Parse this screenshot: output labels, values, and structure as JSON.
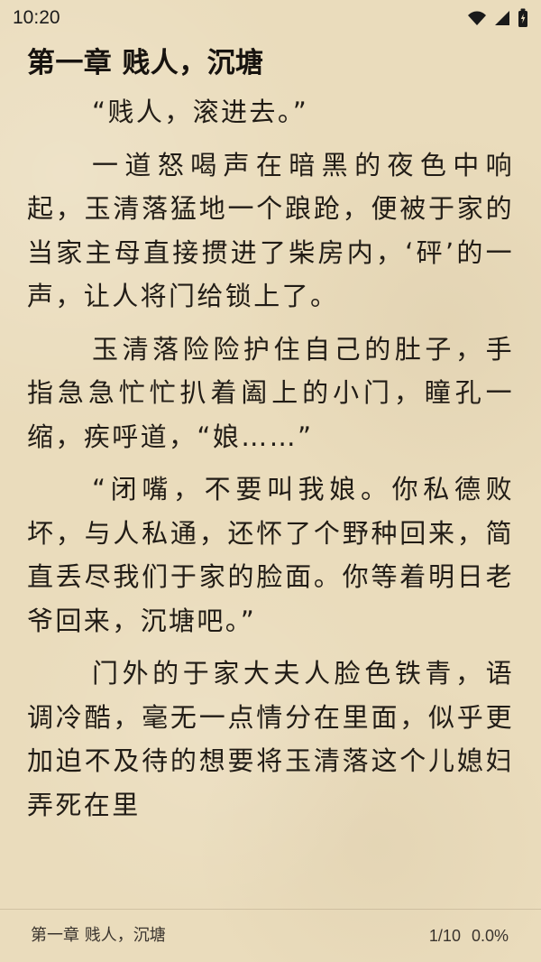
{
  "status_bar": {
    "time": "10:20",
    "icons": [
      "wifi-icon",
      "cellular-signal-icon",
      "battery-charging-icon"
    ]
  },
  "reader": {
    "chapter_title": "第一章  贱人，沉塘",
    "paragraphs": [
      "“贱人，滚进去。”",
      "一道怒喝声在暗黑的夜色中响起，玉清落猛地一个踉跄，便被于家的当家主母直接掼进了柴房内，‘砰’的一声，让人将门给锁上了。",
      "玉清落险险护住自己的肚子，手指急急忙忙扒着阖上的小门，瞳孔一缩，疾呼道，“娘……”",
      "“闭嘴，不要叫我娘。你私德败坏，与人私通，还怀了个野种回来，简直丢尽我们于家的脸面。你等着明日老爷回来，沉塘吧。”",
      "门外的于家大夫人脸色铁青，语调冷酷，毫无一点情分在里面，似乎更加迫不及待的想要将玉清落这个儿媳妇弄死在里"
    ]
  },
  "footer": {
    "chapter": "第一章 贱人，沉塘",
    "page": "1/10",
    "percent": "0.0%"
  },
  "colors": {
    "background": "#eadcbc",
    "text": "#211c16",
    "footer_text": "#3a342e"
  }
}
